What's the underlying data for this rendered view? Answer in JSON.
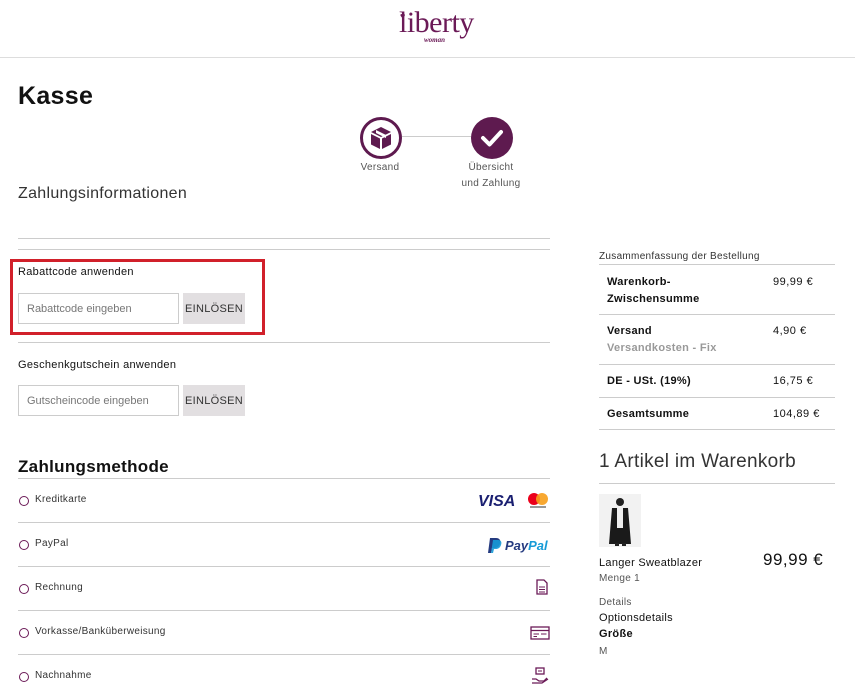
{
  "brand": {
    "logo_text": "liberty",
    "logo_sub": "woman"
  },
  "page_title": "Kasse",
  "steps": [
    {
      "label_line1": "Versand",
      "label_line2": ""
    },
    {
      "label_line1": "Übersicht",
      "label_line2": "und Zahlung"
    }
  ],
  "section_title": "Zahlungsinformationen",
  "coupon": {
    "title": "Rabattcode anwenden",
    "placeholder": "Rabattcode eingeben",
    "button": "EINLÖSEN"
  },
  "gift": {
    "title": "Geschenkgutschein anwenden",
    "placeholder": "Gutscheincode eingeben",
    "button": "EINLÖSEN"
  },
  "payment": {
    "title": "Zahlungsmethode",
    "methods": [
      {
        "label": "Kreditkarte",
        "icon": "visa-mastercard-icon",
        "icon_text": "VISA"
      },
      {
        "label": "PayPal",
        "icon": "paypal-icon",
        "icon_text": "PayPal"
      },
      {
        "label": "Rechnung",
        "icon": "invoice-icon"
      },
      {
        "label": "Vorkasse/Banküberweisung",
        "icon": "bank-transfer-icon"
      },
      {
        "label": "Nachnahme",
        "icon": "cash-on-delivery-icon"
      }
    ]
  },
  "summary": {
    "title": "Zusammenfassung der Bestellung",
    "subtotal_label_1": "Warenkorb-",
    "subtotal_label_2": "Zwischensumme",
    "subtotal_value": "99,99 €",
    "shipping_label": "Versand",
    "shipping_sublabel": "Versandkosten - Fix",
    "shipping_value": "4,90 €",
    "tax_label": "DE - USt. (19%)",
    "tax_value": "16,75 €",
    "total_label": "Gesamtsumme",
    "total_value": "104,89 €"
  },
  "cart": {
    "title": "1 Artikel im Warenkorb",
    "item_name": "Langer Sweatblazer",
    "item_price": "99,99 €",
    "qty": "Menge 1",
    "details": "Details",
    "options": "Optionsdetails",
    "size_label": "Größe",
    "size_value": "M"
  },
  "colors": {
    "accent": "#5e1a4f",
    "highlight": "#d1202a"
  }
}
